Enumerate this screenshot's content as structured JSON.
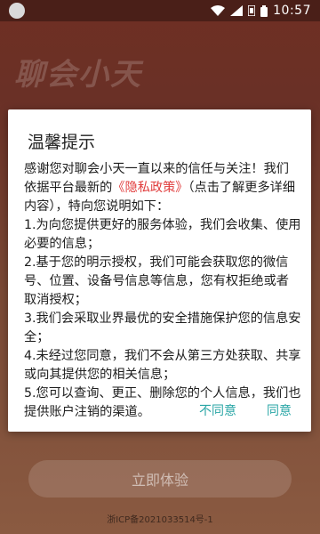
{
  "status_bar": {
    "time": "10:57",
    "icons": [
      "app-notification-icon",
      "wifi-icon",
      "signal-icon",
      "sim-flag-icon",
      "battery-icon"
    ]
  },
  "app": {
    "title": "聊会小天",
    "start_button": "立即体验",
    "icp": "浙ICP备2021033514号-1"
  },
  "dialog": {
    "title": "温馨提示",
    "intro_before_link": "感谢您对聊会小天一直以来的信任与关注！我们依据平台最新的",
    "policy_link": "《隐私政策》",
    "intro_after_link": "（点击了解更多详细内容），特向您说明如下：",
    "points": [
      "1.为向您提供更好的服务体验，我们会收集、使用必要的信息；",
      "2.基于您的明示授权，我们可能会获取您的微信号、位置、设备号信息等信息，您有权拒绝或者取消授权；",
      "3.我们会采取业界最优的安全措施保护您的信息安全；",
      "4.未经过您同意，我们不会从第三方处获取、共享或向其提供您的相关信息；",
      "5.您可以查询、更正、删除您的个人信息，我们也提供账户注销的渠道。"
    ],
    "disagree_label": "不同意",
    "agree_label": "同意"
  },
  "colors": {
    "link": "#e13d3d",
    "action": "#2aa6a6"
  }
}
